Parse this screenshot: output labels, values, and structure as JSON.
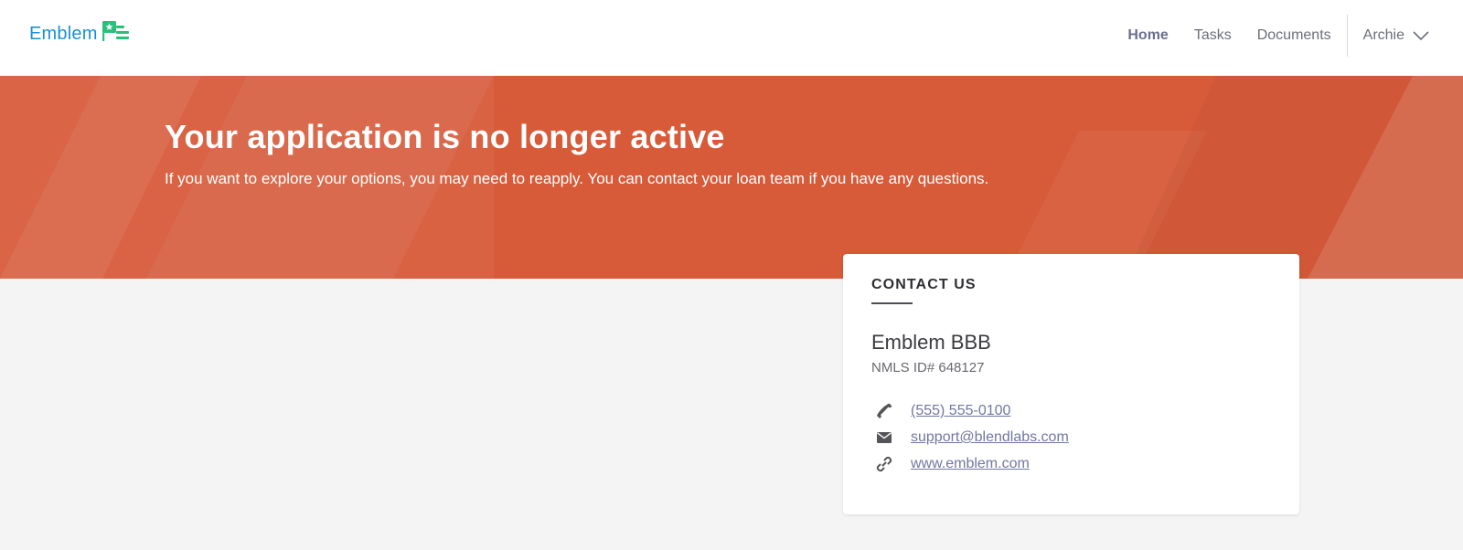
{
  "header": {
    "logo_text": "Emblem",
    "nav": {
      "home": "Home",
      "tasks": "Tasks",
      "documents": "Documents"
    },
    "user_name": "Archie"
  },
  "hero": {
    "title": "Your application is no longer active",
    "subtitle": "If you want to explore your options, you may need to reapply. You can contact your loan team if you have any questions."
  },
  "contact": {
    "heading": "CONTACT US",
    "company": "Emblem BBB",
    "nmls": "NMLS ID# 648127",
    "phone": "(555) 555-0100",
    "email": "support@blendlabs.com",
    "website": "www.emblem.com"
  },
  "icons": {
    "logo": "emblem-flag-logo",
    "chevron": "chevron-down-icon",
    "phone": "phone-icon",
    "email": "mail-icon",
    "website": "link-icon"
  },
  "colors": {
    "brand_blue": "#1c8fd6",
    "brand_green": "#2bbf7a",
    "hero_bg": "#d75a39",
    "link": "#7177a0",
    "page_bg": "#f4f4f4"
  }
}
